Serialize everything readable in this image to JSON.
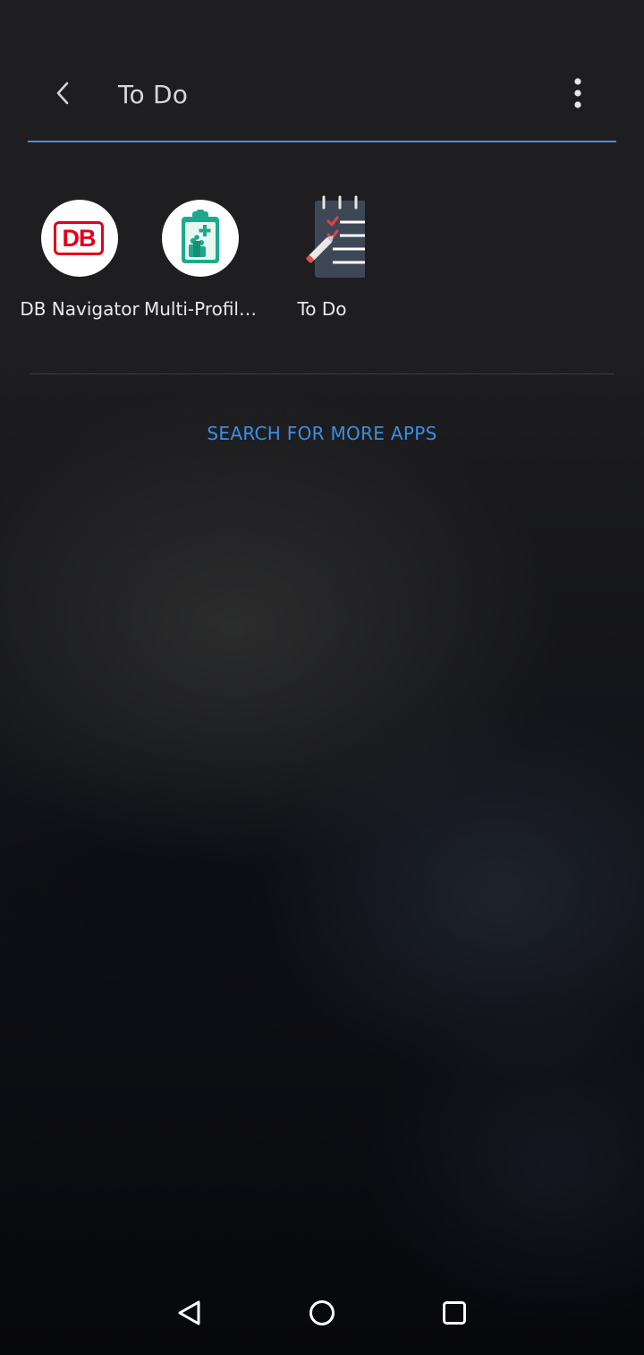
{
  "header": {
    "back_icon": "chevron-left-icon",
    "title": "To Do",
    "more_icon": "more-vertical-icon",
    "accent_color": "#4a8fd6"
  },
  "apps": [
    {
      "label": "DB Navigator",
      "icon": "db-navigator-icon",
      "brand_color": "#e2001a",
      "icon_text": "DB"
    },
    {
      "label": "Multi-Profil…",
      "icon": "clipboard-medical-icon",
      "brand_color": "#1fa98c"
    },
    {
      "label": "To Do",
      "icon": "notepad-checklist-icon"
    }
  ],
  "search_more": {
    "label": "SEARCH FOR MORE APPS",
    "color": "#3f8ee0"
  },
  "nav": {
    "back_icon": "triangle-back-icon",
    "home_icon": "circle-home-icon",
    "recents_icon": "square-recents-icon"
  }
}
